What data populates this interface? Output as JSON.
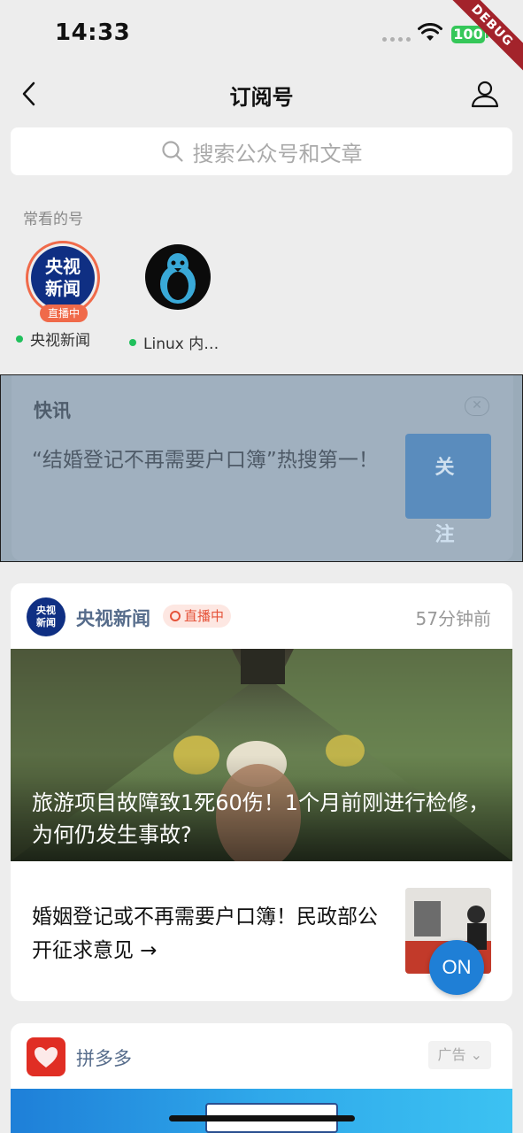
{
  "status_bar": {
    "time": "14:33",
    "battery": "100",
    "debug_label": "DEBUG"
  },
  "nav": {
    "title": "订阅号"
  },
  "search": {
    "placeholder": "搜索公众号和文章"
  },
  "frequent": {
    "label": "常看的号",
    "items": [
      {
        "name": "央视新闻",
        "avatar_text_1": "央视",
        "avatar_text_2": "新闻",
        "live_tag": "直播中",
        "online": true
      },
      {
        "name": "Linux 内…",
        "online": true
      }
    ]
  },
  "flash": {
    "title": "快讯",
    "text": "“结婚登记不再需要户口簿”热搜第一！",
    "follow_label": "关注"
  },
  "article_card": {
    "source": "央视新闻",
    "logo_line_1": "央视",
    "logo_line_2": "新闻",
    "live_label": "直播中",
    "time": "57分钟前",
    "hero_title": "旅游项目故障致1死60伤！1个月前刚进行检修，为何仍发生事故?",
    "sub_title": "婚姻登记或不再需要户口簿！民政部公开征求意见 →",
    "on_label": "ON"
  },
  "ad_card": {
    "source": "拼多多",
    "tag": "广告"
  },
  "colors": {
    "accent_live": "#f06a4a",
    "online_dot": "#20c05c",
    "source_blue": "#566c8b",
    "on_button": "#1f7fd6"
  }
}
